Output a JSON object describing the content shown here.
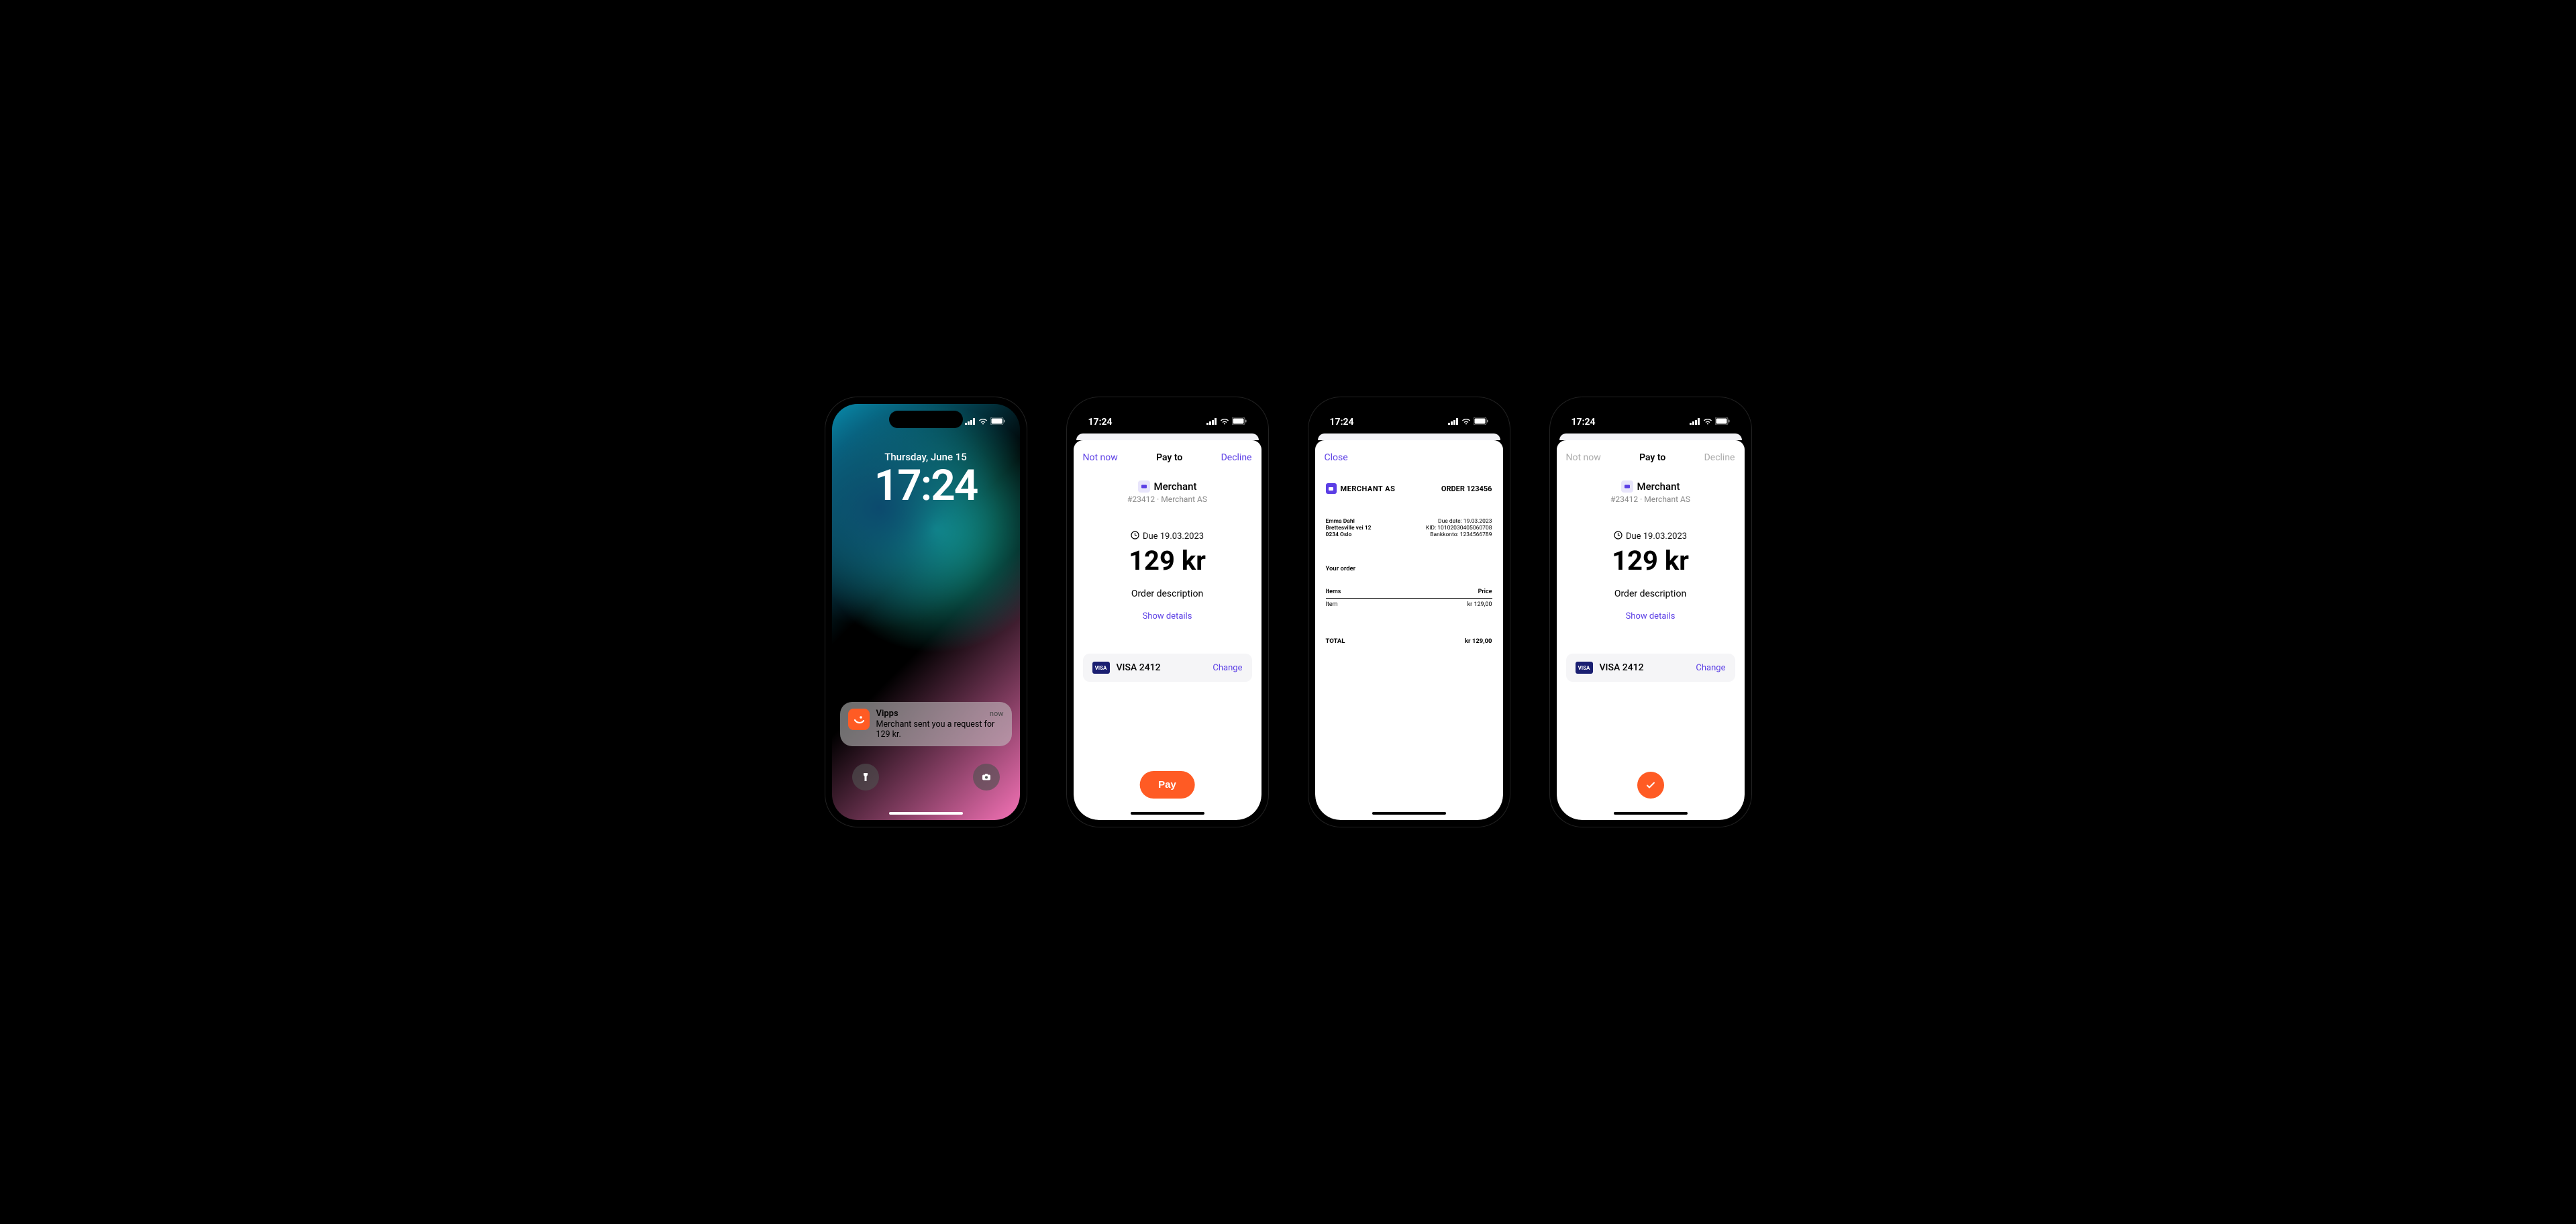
{
  "status": {
    "time": "17:24"
  },
  "lock": {
    "date": "Thursday, June 15",
    "time": "17:24",
    "notif_app": "Vipps",
    "notif_time": "now",
    "notif_msg": "Merchant sent you a request for 129 kr."
  },
  "pay": {
    "not_now": "Not now",
    "title": "Pay to",
    "decline": "Decline",
    "merchant": "Merchant",
    "merchant_sub": "#23412 · Merchant AS",
    "due": "Due 19.03.2023",
    "amount": "129 kr",
    "order_desc": "Order description",
    "show_details": "Show details",
    "card": "VISA 2412",
    "change": "Change",
    "pay_btn": "Pay"
  },
  "invoice": {
    "close": "Close",
    "merchant": "MERCHANT AS",
    "order": "ORDER 123456",
    "customer_name": "Emma Dahl",
    "customer_addr1": "Brettesville vei 12",
    "customer_addr2": "0234 Oslo",
    "due_label": "Due date:",
    "due_value": "19.03.2023",
    "kid_label": "KID:",
    "kid_value": "10102030405060708",
    "bank_label": "Bankkonto:",
    "bank_value": "1234566789",
    "your_order": "Your order",
    "items_head": "Items",
    "price_head": "Price",
    "item_name": "Item",
    "item_price": "kr 129,00",
    "total_label": "TOTAL",
    "total_value": "kr 129,00"
  },
  "visa_badge": "VISA"
}
